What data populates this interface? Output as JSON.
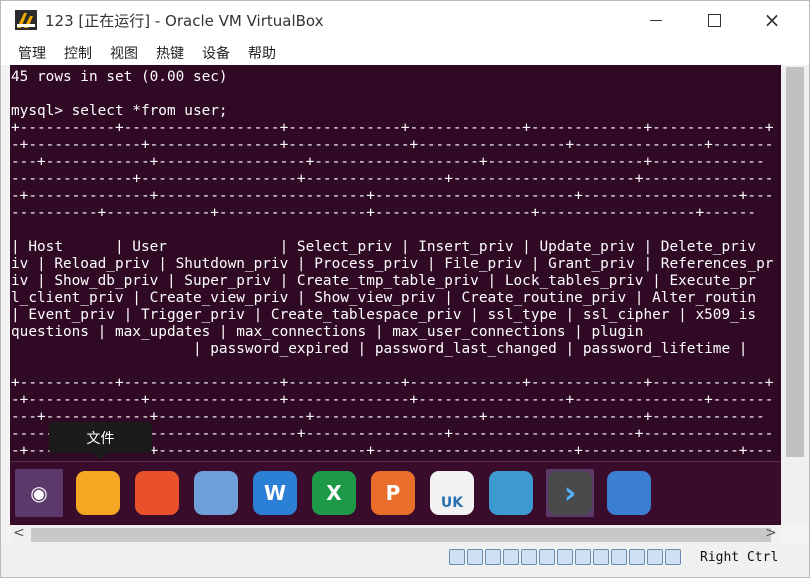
{
  "window": {
    "title": "123 [正在运行] - Oracle VM VirtualBox",
    "controls": {
      "minimize": "minimize",
      "maximize": "maximize",
      "close": "×"
    }
  },
  "menu": [
    "管理",
    "控制",
    "视图",
    "热键",
    "设备",
    "帮助"
  ],
  "terminal": {
    "lines": [
      "45 rows in set (0.00 sec)",
      "",
      "mysql> select *from user;",
      "+-----------+------------------+-------------+-------------+-------------+-------------+",
      "-+-------------+---------------+--------------+-----------------+---------------+-------",
      "---+------------+-----------------+-------------------+------------------+-------------",
      "--------------+------------------+----------------+---------------------+---------------",
      "-+--------------+------------------------+-----------------------+------------------+---",
      "----------+------------+-----------------+------------------+------------------+------",
      "",
      "| Host      | User             | Select_priv | Insert_priv | Update_priv | Delete_priv",
      "iv | Reload_priv | Shutdown_priv | Process_priv | File_priv | Grant_priv | References_pr",
      "iv | Show_db_priv | Super_priv | Create_tmp_table_priv | Lock_tables_priv | Execute_pr",
      "l_client_priv | Create_view_priv | Show_view_priv | Create_routine_priv | Alter_routin",
      "| Event_priv | Trigger_priv | Create_tablespace_priv | ssl_type | ssl_cipher | x509_is",
      "questions | max_updates | max_connections | max_user_connections | plugin",
      "                     | password_expired | password_last_changed | password_lifetime |",
      "",
      "+-----------+------------------+-------------+-------------+-------------+-------------+",
      "-+-------------+---------------+--------------+-----------------+---------------+-------",
      "---+------------+-----------------+-------------------+------------------+-------------",
      "--------------+------------------+----------------+---------------------+---------------",
      "-+--------------+------------------------+-----------------------+------------------+---"
    ]
  },
  "tooltip": "文件",
  "dock": [
    {
      "name": "ubuntu-icon",
      "color": "#5b3a6b",
      "glyph": "◉",
      "active": true
    },
    {
      "name": "files-folder-icon",
      "color": "#f5a623",
      "glyph": "",
      "active": false
    },
    {
      "name": "firefox-icon",
      "color": "#e8512a",
      "glyph": "",
      "active": false
    },
    {
      "name": "chromium-icon",
      "color": "#6f9fd8",
      "glyph": "",
      "active": false
    },
    {
      "name": "writer-icon",
      "color": "#2b7fd4",
      "glyph": "W",
      "active": false
    },
    {
      "name": "calc-icon",
      "color": "#1d9a48",
      "glyph": "X",
      "active": false
    },
    {
      "name": "impress-icon",
      "color": "#e96d2b",
      "glyph": "P",
      "active": false
    },
    {
      "name": "software-center-icon",
      "color": "#f2f2f2",
      "glyph": "UK",
      "active": false
    },
    {
      "name": "vm-system-icon",
      "color": "#3d9ad1",
      "glyph": "",
      "active": false
    },
    {
      "name": "terminal-icon",
      "color": "#4a4a4a",
      "glyph": "›",
      "active": true
    },
    {
      "name": "app-grid-icon",
      "color": "#3b7fd0",
      "glyph": "",
      "active": false
    }
  ],
  "scroll": {
    "left_arrow": "<",
    "right_arrow": ">"
  },
  "status": {
    "host_key": "Right Ctrl",
    "icon_count": 13
  }
}
